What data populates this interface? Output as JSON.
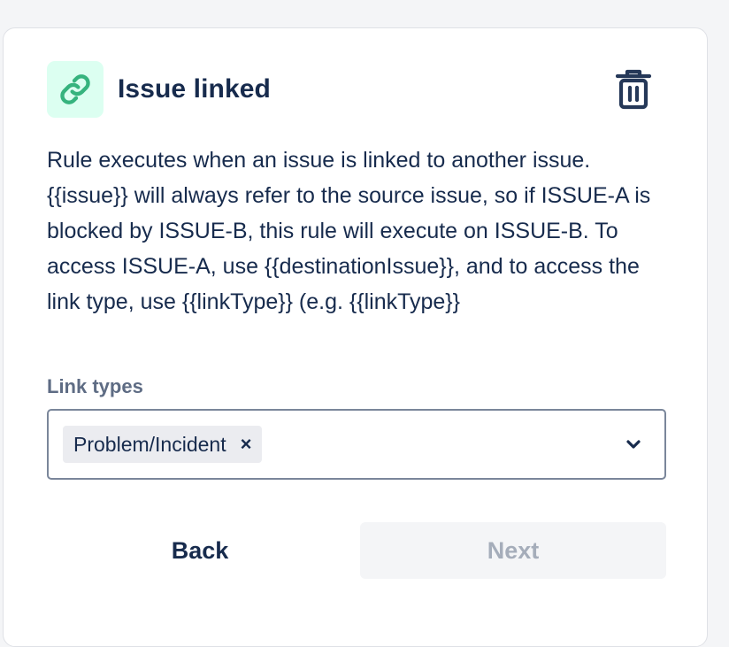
{
  "trigger": {
    "title": "Issue linked",
    "icon": "link-icon",
    "accent_color": "#36b37e",
    "icon_background": "#dcfff1",
    "delete_icon": "trash-icon",
    "description": "Rule executes when an issue is linked to another issue. {{issue}} will always refer to the source issue, so if ISSUE-A is blocked by ISSUE-B, this rule will execute on ISSUE-B. To access ISSUE-A, use {{destinationIssue}}, and to access the link type, use {{linkType}} (e.g. {{linkType}}"
  },
  "link_types": {
    "label": "Link types",
    "selected": [
      {
        "label": "Problem/Incident",
        "remove_glyph": "×"
      }
    ],
    "dropdown_icon": "chevron-down-icon"
  },
  "actions": {
    "back_label": "Back",
    "next_label": "Next",
    "next_disabled": true
  }
}
